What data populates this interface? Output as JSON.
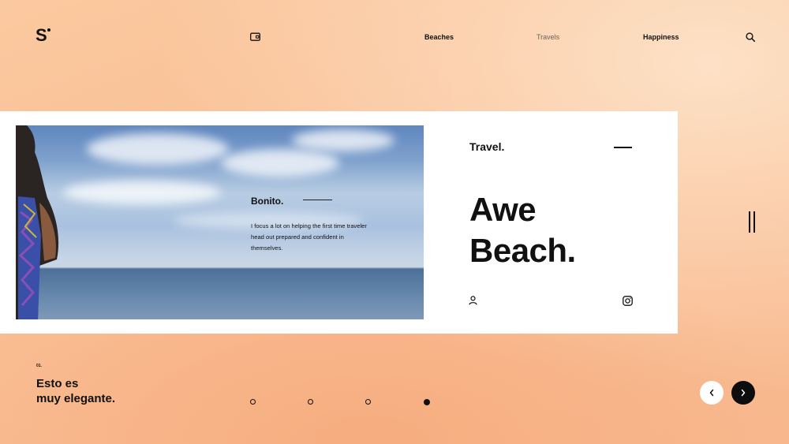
{
  "brand": {
    "logo_text": "S"
  },
  "nav": {
    "items": [
      {
        "label": "Beaches"
      },
      {
        "label": "Travels"
      },
      {
        "label": "Happiness"
      }
    ],
    "icons": [
      "wallet-icon",
      "search-icon"
    ]
  },
  "card": {
    "photo": {
      "title": "Bonito.",
      "text": "I focus a lot on helping the first time traveler head out prepared and confident in themselves."
    },
    "kicker": "Travel.",
    "headline_line1": "Awe",
    "headline_line2": "Beach.",
    "icons": [
      "user-icon",
      "instagram-icon"
    ]
  },
  "slider": {
    "number": "01.",
    "tagline_line1": "Esto es",
    "tagline_line2": "muy elegante.",
    "dots_total": 4,
    "active_dot": 4
  },
  "colors": {
    "background": "#f9bd92",
    "text": "#111111",
    "card": "#ffffff",
    "muted_nav": "#6f6258"
  }
}
